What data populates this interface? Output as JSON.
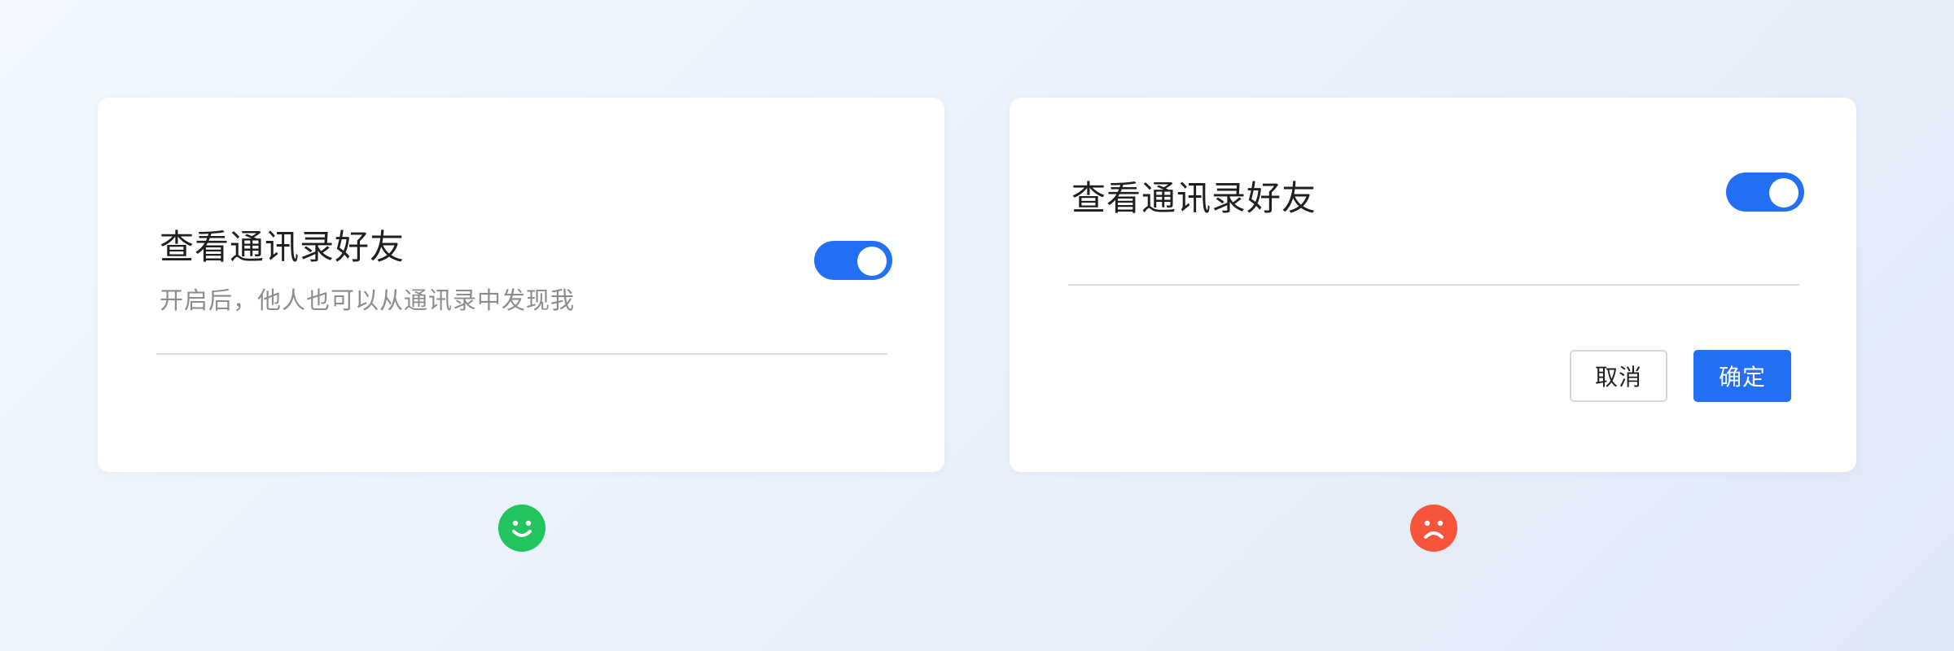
{
  "good_example": {
    "title": "查看通讯录好友",
    "subtitle": "开启后，他人也可以从通讯录中发现我",
    "toggle_on": true,
    "feedback_icon": "smile-icon",
    "feedback_color": "#22c55e"
  },
  "bad_example": {
    "title": "查看通讯录好友",
    "toggle_on": true,
    "cancel_label": "取消",
    "confirm_label": "确定",
    "feedback_icon": "frown-icon",
    "feedback_color": "#f7553b"
  },
  "colors": {
    "accent": "#2370f5",
    "divider": "#dcdcdc",
    "text_primary": "#1f1f1f",
    "text_secondary": "#8c8c8c"
  }
}
